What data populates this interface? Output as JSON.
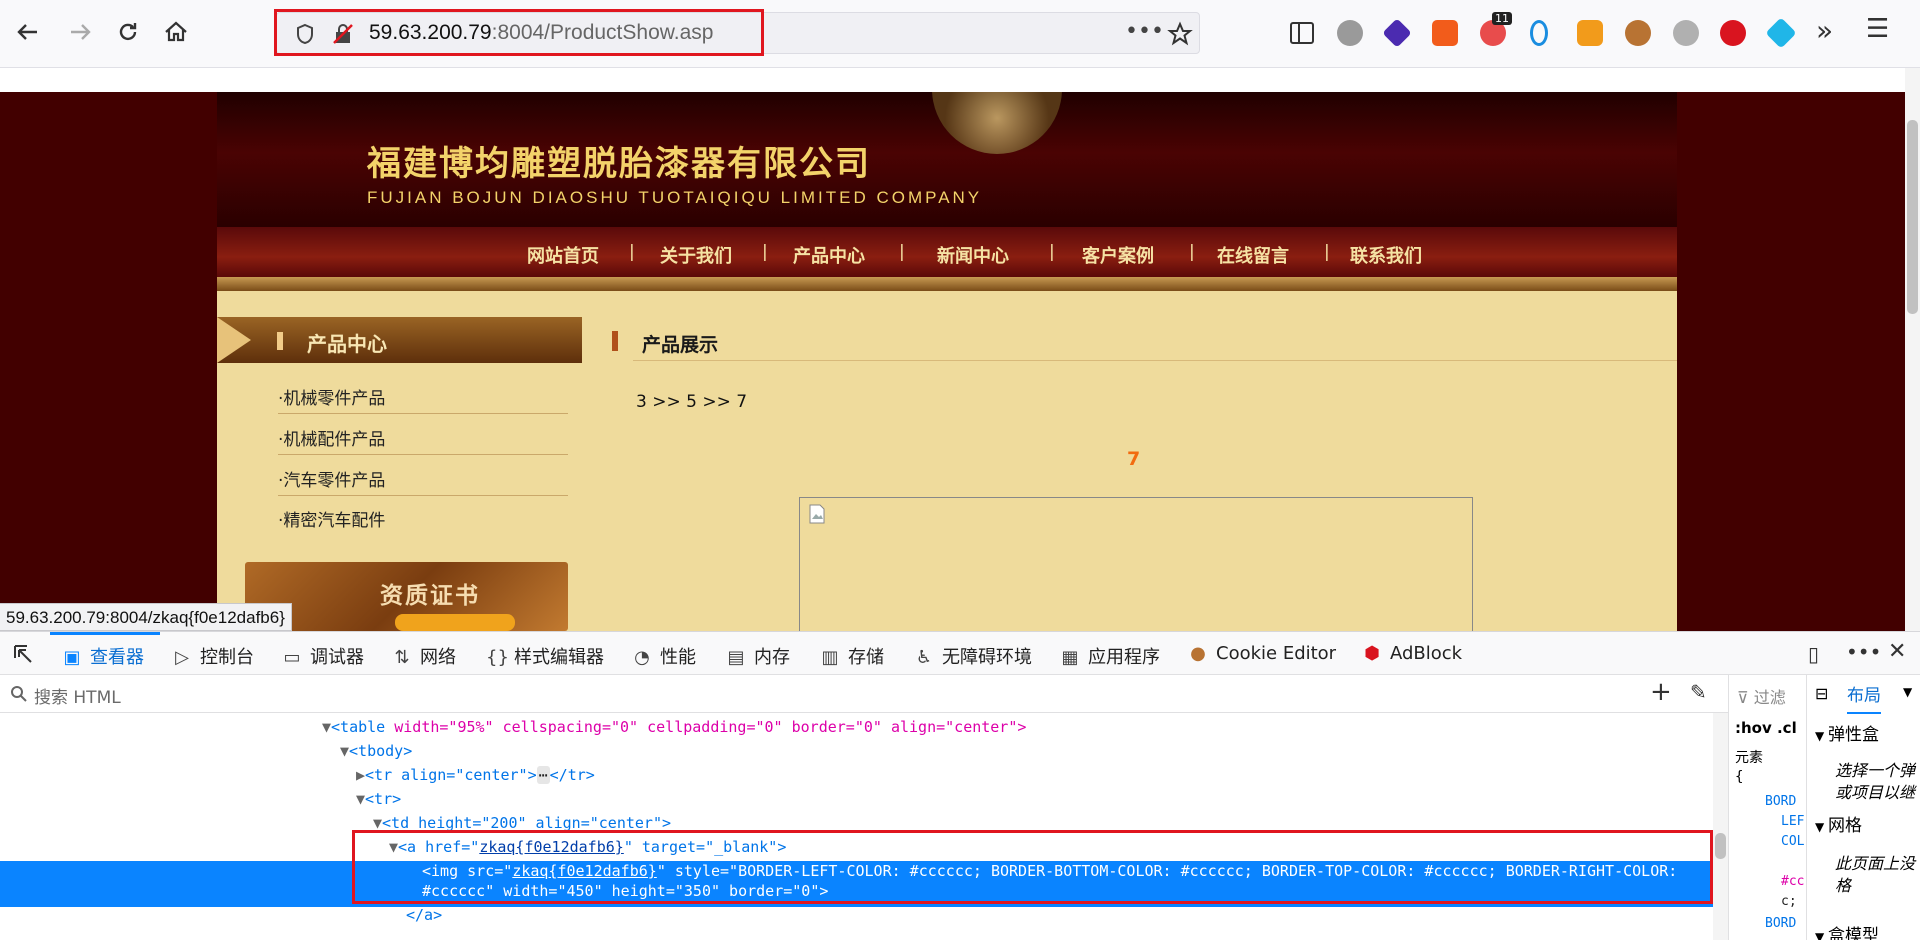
{
  "browser": {
    "url_host": "59.63.200.79",
    "url_path": ":8004/ProductShow.asp",
    "extension_badge": "11",
    "status_url": "59.63.200.79:8004/zkaq{f0e12dafb6}"
  },
  "site": {
    "company_cn": "福建博均雕塑脱胎漆器有限公司",
    "company_en": "FUJIAN BOJUN DIAOSHU  TUOTAIQIQU  LIMITED COMPANY",
    "nav": [
      "网站首页",
      "关于我们",
      "产品中心",
      "新闻中心",
      "客户案例",
      "在线留言",
      "联系我们"
    ],
    "nav_sep": "|",
    "sidebar_title": "产品中心",
    "sidebar_items": [
      "·机械零件产品",
      "·机械配件产品",
      "·汽车零件产品",
      "·精密汽车配件"
    ],
    "cert_title": "资质证书",
    "main_title": "产品展示",
    "breadcrumb": "3 >> 5 >> 7",
    "product_name": "7"
  },
  "devtools": {
    "tabs": [
      "查看器",
      "控制台",
      "调试器",
      "网络",
      "样式编辑器",
      "性能",
      "内存",
      "存储",
      "无障碍环境",
      "应用程序",
      "Cookie Editor",
      "AdBlock"
    ],
    "search_placeholder": "搜索 HTML",
    "right_tab": "布局",
    "filter_placeholder": "过滤",
    "hov": ":hov .cl",
    "element_label": "元素",
    "brace": "{",
    "sections": [
      "弹性盒",
      "网格",
      "盒模型"
    ],
    "flex_note": "选择一个弹\n或项目以继",
    "grid_note": "此页面上没\n格",
    "markup": {
      "l1_tag": "<table",
      "l1_attrs": " width=\"95%\" cellspacing=\"0\" cellpadding=\"0\" border=\"0\" align=\"center\">",
      "l2": "<tbody>",
      "l3": "<tr align=\"center\">",
      "l3_end": "</tr>",
      "l4": "<tr>",
      "l5": "<td height=\"200\" align=\"center\">",
      "l6_a": "<a href=\"",
      "l6_link": "zkaq{f0e12dafb6}",
      "l6_b": "\" target=\"_blank\">",
      "l7_a": "<img src=\"",
      "l7_link": "zkaq{f0e12dafb6}",
      "l7_b": "\" style=\"BORDER-LEFT-COLOR: #cccccc; BORDER-BOTTOM-COLOR: #cccccc; BORDER-TOP-COLOR: #cccccc; BORDER-RIGHT-COLOR:",
      "l8": "#cccccc\" width=\"450\" height=\"350\" border=\"0\">",
      "l9": "</a>"
    },
    "rules_fragments": [
      "BORD",
      "LEF",
      "COL",
      "#cc",
      "c;",
      "BORD"
    ]
  },
  "colors": {
    "highlight_box": "#e0161f",
    "selection": "#0a84ff",
    "page_bg": "#420000"
  }
}
